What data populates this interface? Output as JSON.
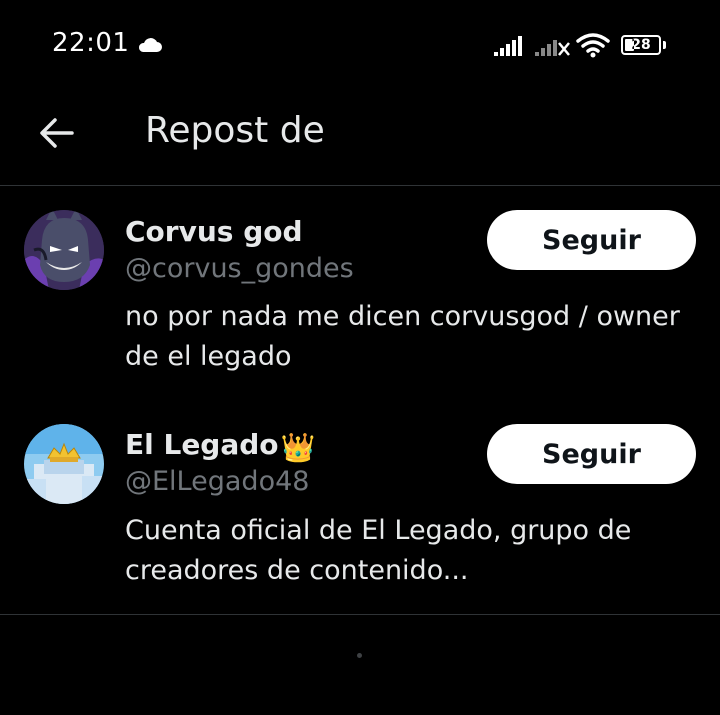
{
  "status_bar": {
    "time": "22:01",
    "battery": "28",
    "battery_level_pct": 28,
    "icons": [
      "cloud-icon",
      "signal-icon",
      "signal-no-service-icon",
      "wifi-icon",
      "battery-icon"
    ]
  },
  "header": {
    "back_icon": "arrow-left-icon",
    "title": "Repost de"
  },
  "users": [
    {
      "display_name": "Corvus god",
      "handle": "@corvus_gondes",
      "bio": "no por nada me dicen corvusgod / owner de el legado",
      "follow_label": "Seguir"
    },
    {
      "display_name": "El Legado",
      "badge": "👑",
      "handle": "@ElLegado48",
      "bio": "Cuenta oficial de El Legado, grupo de creadores de contenido...",
      "follow_label": "Seguir"
    }
  ],
  "colors": {
    "background": "#000000",
    "text_primary": "#e7e9ea",
    "text_secondary": "#71767b",
    "button_bg": "#ffffff",
    "button_text": "#0f1419",
    "divider": "#2f3336"
  }
}
